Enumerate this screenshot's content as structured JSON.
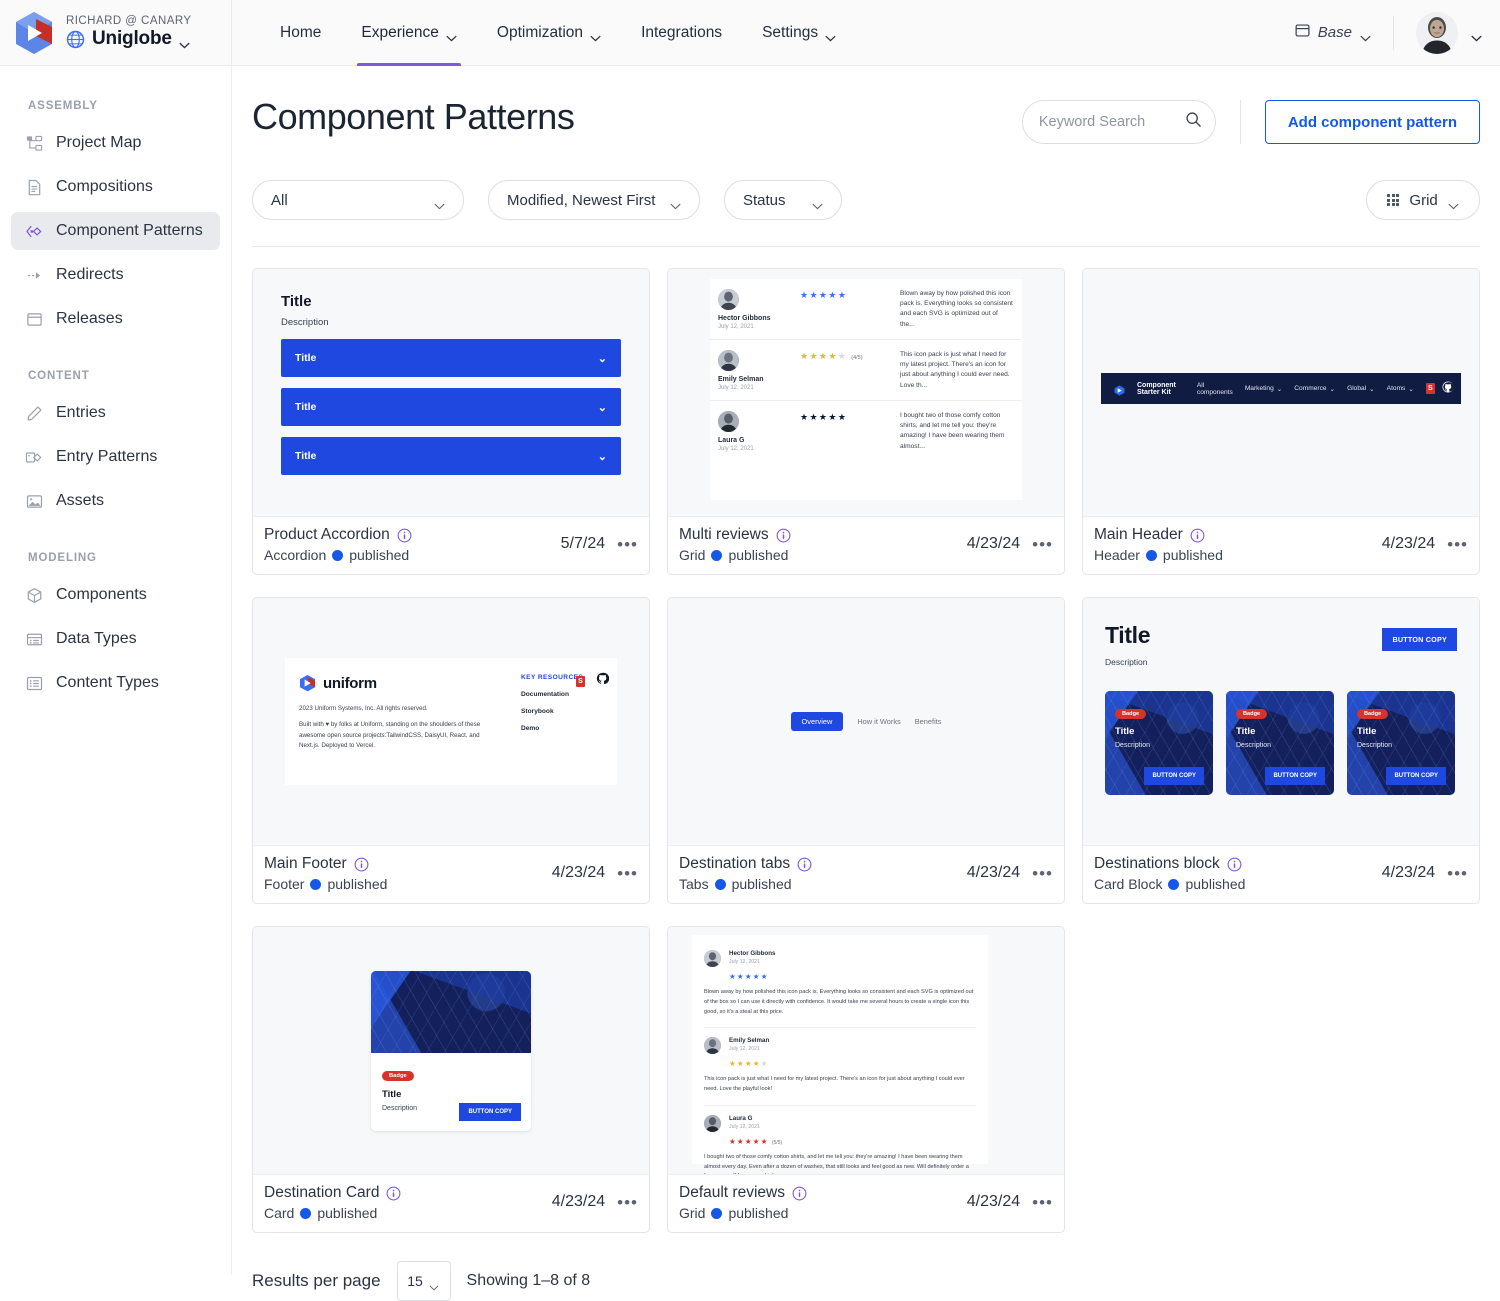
{
  "topbar": {
    "org": "RICHARD @ CANARY",
    "project": "Uniglobe",
    "nav": [
      {
        "label": "Home",
        "caret": false,
        "active": false
      },
      {
        "label": "Experience",
        "caret": true,
        "active": true
      },
      {
        "label": "Optimization",
        "caret": true,
        "active": false
      },
      {
        "label": "Integrations",
        "caret": false,
        "active": false
      },
      {
        "label": "Settings",
        "caret": true,
        "active": false
      }
    ],
    "base_label": "Base"
  },
  "sidebar": {
    "groups": [
      {
        "label": "ASSEMBLY",
        "items": [
          {
            "label": "Project Map",
            "icon": "project-map-icon",
            "active": false
          },
          {
            "label": "Compositions",
            "icon": "document-icon",
            "active": false
          },
          {
            "label": "Component Patterns",
            "icon": "component-pattern-icon",
            "active": true
          },
          {
            "label": "Redirects",
            "icon": "arrow-right-icon",
            "active": false
          },
          {
            "label": "Releases",
            "icon": "window-icon",
            "active": false
          }
        ]
      },
      {
        "label": "CONTENT",
        "items": [
          {
            "label": "Entries",
            "icon": "pencil-icon",
            "active": false
          },
          {
            "label": "Entry Patterns",
            "icon": "tag-icon",
            "active": false
          },
          {
            "label": "Assets",
            "icon": "image-icon",
            "active": false
          }
        ]
      },
      {
        "label": "MODELING",
        "items": [
          {
            "label": "Components",
            "icon": "cube-icon",
            "active": false
          },
          {
            "label": "Data Types",
            "icon": "list-icon",
            "active": false
          },
          {
            "label": "Content Types",
            "icon": "list-alt-icon",
            "active": false
          }
        ]
      }
    ]
  },
  "page": {
    "title": "Component Patterns",
    "search_placeholder": "Keyword Search",
    "search_value": "",
    "add_button": "Add component pattern",
    "filters": {
      "type": "All",
      "sort": "Modified, Newest First",
      "status": "Status",
      "view": "Grid"
    }
  },
  "cards": [
    {
      "name": "Product Accordion",
      "type": "Accordion",
      "status": "published",
      "date": "5/7/24",
      "preview": "accordion",
      "preview_data": {
        "title": "Title",
        "description": "Description",
        "rows": [
          "Title",
          "Title",
          "Title"
        ]
      }
    },
    {
      "name": "Multi reviews",
      "type": "Grid",
      "status": "published",
      "date": "4/23/24",
      "preview": "multi-reviews",
      "preview_data": {
        "reviews": [
          {
            "author": "Hector Gibbons",
            "date": "July 12, 2021",
            "stars": 5,
            "star_color": "#3b6ef0",
            "fraction": "",
            "text": "Blown away by how polished this icon pack is. Everything looks so consistent and each SVG is optimized out of the..."
          },
          {
            "author": "Emily Selman",
            "date": "July 12, 2021",
            "stars": 4,
            "star_color": "#f0b429",
            "fraction": "(4/5)",
            "text": "This icon pack is just what I need for my latest project. There's an icon for just about anything I could ever need. Love th..."
          },
          {
            "author": "Laura G",
            "date": "July 12, 2021",
            "stars": 5,
            "star_color": "#0b1733",
            "fraction": "",
            "text": "I bought two of those comfy cotton shirts, and let me tell you: they're amazing! I have been wearing them almost..."
          }
        ]
      }
    },
    {
      "name": "Main Header",
      "type": "Header",
      "status": "published",
      "date": "4/23/24",
      "preview": "header",
      "preview_data": {
        "brand": "Component Starter Kit",
        "links": [
          {
            "label": "All components",
            "caret": false
          },
          {
            "label": "Marketing",
            "caret": true
          },
          {
            "label": "Commerce",
            "caret": true
          },
          {
            "label": "Global",
            "caret": true
          },
          {
            "label": "Atoms",
            "caret": true
          }
        ]
      }
    },
    {
      "name": "Main Footer",
      "type": "Footer",
      "status": "published",
      "date": "4/23/24",
      "preview": "footer",
      "preview_data": {
        "wordmark": "uniform",
        "copyright": "2023 Uniform Systems, Inc. All rights reserved.",
        "built_with": "Built with ♥ by folks at Uniform, standing on the shoulders of these awesome open source projects:TailwindCSS, DaisyUI, React, and Next.js. Deployed to Vercel.",
        "column_title": "KEY RESOURCES",
        "column_links": [
          "Documentation",
          "Storybook",
          "Demo"
        ]
      }
    },
    {
      "name": "Destination tabs",
      "type": "Tabs",
      "status": "published",
      "date": "4/23/24",
      "preview": "tabs",
      "preview_data": {
        "tabs": [
          {
            "label": "Overview",
            "active": true
          },
          {
            "label": "How it Works",
            "active": false
          },
          {
            "label": "Benefits",
            "active": false
          }
        ]
      }
    },
    {
      "name": "Destinations block",
      "type": "Card Block",
      "status": "published",
      "date": "4/23/24",
      "preview": "destinations-block",
      "preview_data": {
        "title": "Title",
        "description": "Description",
        "button": "BUTTON COPY",
        "cards": [
          {
            "badge": "Badge",
            "title": "Title",
            "description": "Description",
            "button": "BUTTON COPY"
          },
          {
            "badge": "Badge",
            "title": "Title",
            "description": "Description",
            "button": "BUTTON COPY"
          },
          {
            "badge": "Badge",
            "title": "Title",
            "description": "Description",
            "button": "BUTTON COPY"
          }
        ]
      }
    },
    {
      "name": "Destination Card",
      "type": "Card",
      "status": "published",
      "date": "4/23/24",
      "preview": "destination-card",
      "preview_data": {
        "badge": "Badge",
        "title": "Title",
        "description": "Description",
        "button": "BUTTON COPY"
      }
    },
    {
      "name": "Default reviews",
      "type": "Grid",
      "status": "published",
      "date": "4/23/24",
      "preview": "default-reviews",
      "preview_data": {
        "reviews": [
          {
            "author": "Hector Gibbons",
            "date": "July 12, 2021",
            "stars": 5,
            "star_color": "#3b6ef0",
            "fraction": "",
            "text": "Blown away by how polished this icon pack is. Everything looks so consistent and each SVG is optimized out of the box so I can use it directly with confidence. It would take me several hours to create a single icon this good, so it's a steal at this price."
          },
          {
            "author": "Emily Selman",
            "date": "July 12, 2021",
            "stars": 4,
            "star_color": "#f0b429",
            "fraction": "",
            "text": "This icon pack is just what I need for my latest project. There's an icon for just about anything I could ever need. Love the playful look!"
          },
          {
            "author": "Laura G",
            "date": "July 12, 2021",
            "stars": 5,
            "star_color": "#d8332a",
            "fraction": "(5/5)",
            "text": "I bought two of those comfy cotton shirts, and let me tell you: they're amazing! I have been wearing them almost every day. Even after a dozen of washes, that still looks and feel good as new. Will definitely order a few more... If I ever need to!"
          }
        ]
      }
    }
  ],
  "pagination": {
    "label": "Results per page",
    "per_page": "15",
    "showing": "Showing 1–8 of 8"
  },
  "colors": {
    "accent_purple": "#7c5cd6",
    "link_blue": "#1558e8",
    "status_blue": "#1558e8",
    "brand_navy": "#111c42",
    "badge_red": "#d8332a"
  }
}
